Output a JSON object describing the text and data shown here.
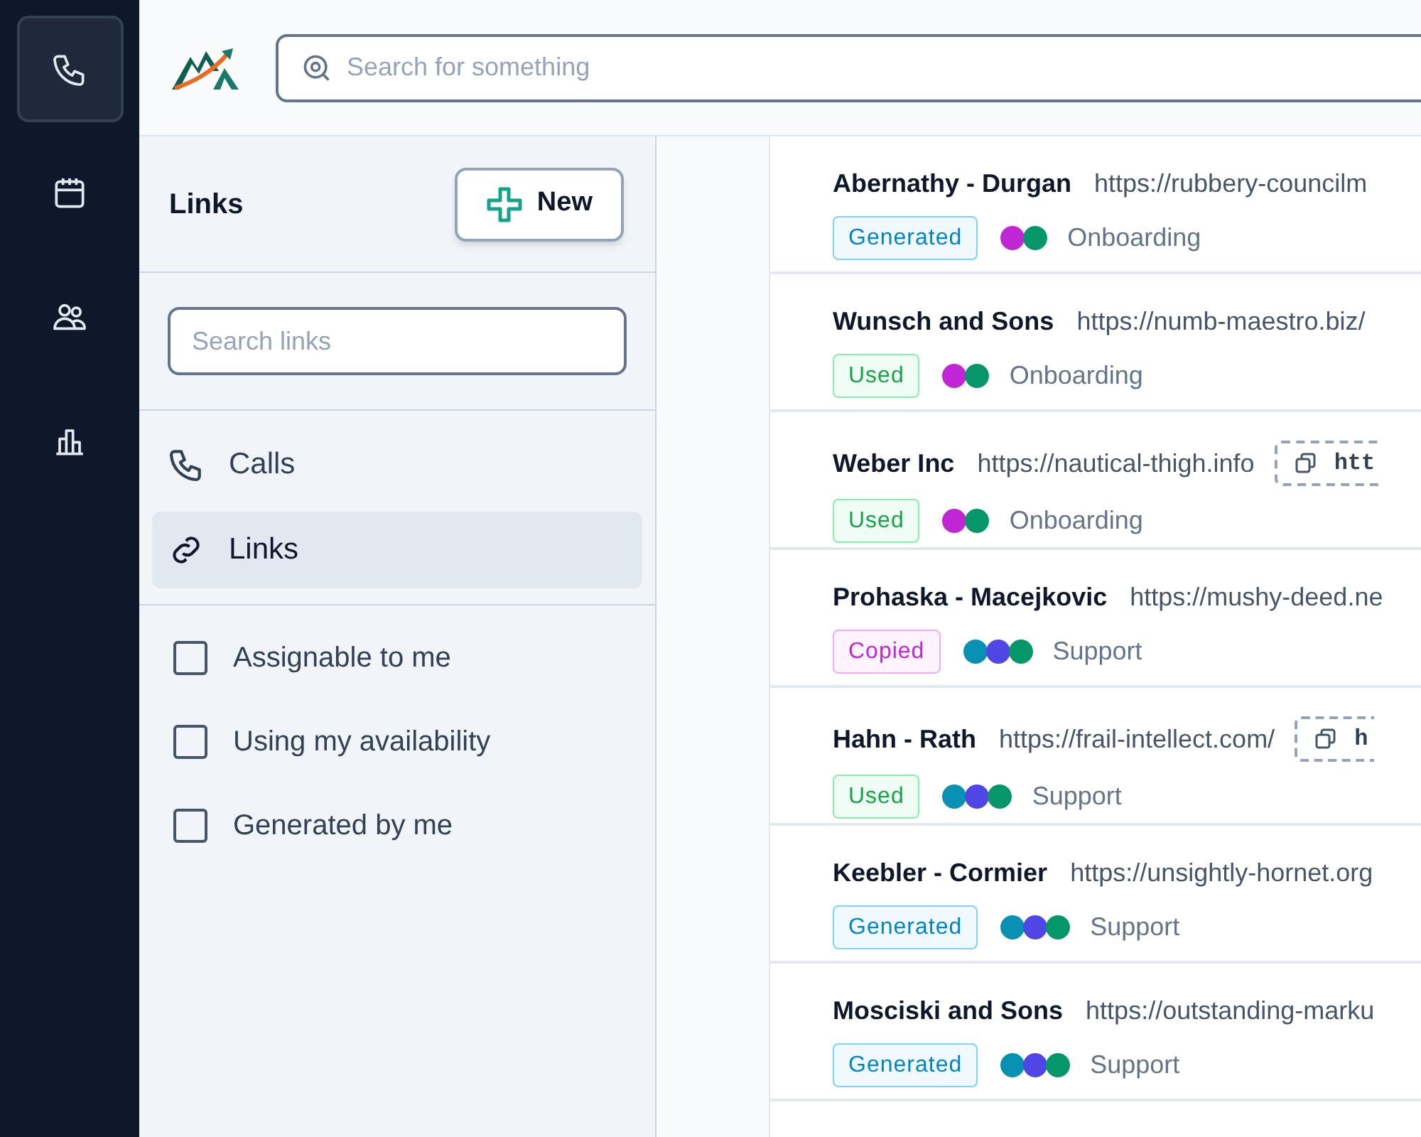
{
  "rail": [
    {
      "kind": "phone",
      "selected": true
    },
    {
      "kind": "calendar",
      "selected": false
    },
    {
      "kind": "users",
      "selected": false
    },
    {
      "kind": "chart",
      "selected": false
    }
  ],
  "search": {
    "placeholder": "Search for something"
  },
  "panel": {
    "title": "Links",
    "new_button": "New",
    "search": {
      "placeholder": "Search links"
    },
    "nav": [
      {
        "kind": "phone",
        "label": "Calls",
        "selected": false
      },
      {
        "kind": "link",
        "label": "Links",
        "selected": true
      }
    ],
    "filters": [
      {
        "label": "Assignable to me",
        "checked": false
      },
      {
        "label": "Using my availability",
        "checked": false
      },
      {
        "label": "Generated by me",
        "checked": false
      }
    ]
  },
  "links": [
    {
      "name": "Abernathy - Durgan",
      "url": "https://rubbery-councilm",
      "status": {
        "kind": "generated",
        "label": "Generated"
      },
      "dots": [
        {
          "color": "#c026d3"
        },
        {
          "color": "#059669"
        }
      ],
      "team": "Onboarding"
    },
    {
      "name": "Wunsch and Sons",
      "url": "https://numb-maestro.biz/",
      "status": {
        "kind": "used",
        "label": "Used"
      },
      "dots": [
        {
          "color": "#c026d3"
        },
        {
          "color": "#059669"
        }
      ],
      "team": "Onboarding"
    },
    {
      "name": "Weber Inc",
      "url": "https://nautical-thigh.info",
      "copy": "htt",
      "status": {
        "kind": "used",
        "label": "Used"
      },
      "dots": [
        {
          "color": "#c026d3"
        },
        {
          "color": "#059669"
        }
      ],
      "team": "Onboarding"
    },
    {
      "name": "Prohaska - Macejkovic",
      "url": "https://mushy-deed.ne",
      "status": {
        "kind": "copied",
        "label": "Copied"
      },
      "dots": [
        {
          "color": "#0891b2"
        },
        {
          "color": "#4f46e5"
        },
        {
          "color": "#059669"
        }
      ],
      "team": "Support"
    },
    {
      "name": "Hahn - Rath",
      "url": "https://frail-intellect.com/",
      "copy": "h",
      "status": {
        "kind": "used",
        "label": "Used"
      },
      "dots": [
        {
          "color": "#0891b2"
        },
        {
          "color": "#4f46e5"
        },
        {
          "color": "#059669"
        }
      ],
      "team": "Support"
    },
    {
      "name": "Keebler - Cormier",
      "url": "https://unsightly-hornet.org",
      "status": {
        "kind": "generated",
        "label": "Generated"
      },
      "dots": [
        {
          "color": "#0891b2"
        },
        {
          "color": "#4f46e5"
        },
        {
          "color": "#059669"
        }
      ],
      "team": "Support"
    },
    {
      "name": "Mosciski and Sons",
      "url": "https://outstanding-marku",
      "status": {
        "kind": "generated",
        "label": "Generated"
      },
      "dots": [
        {
          "color": "#0891b2"
        },
        {
          "color": "#4f46e5"
        },
        {
          "color": "#059669"
        }
      ],
      "team": "Support"
    }
  ]
}
